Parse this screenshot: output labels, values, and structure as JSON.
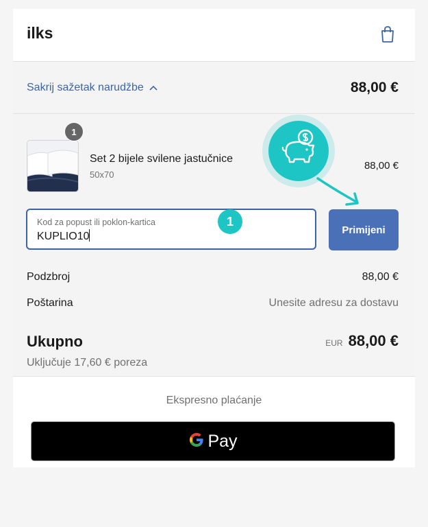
{
  "header": {
    "brand": "ilks",
    "bag_icon": "shopping-bag-icon"
  },
  "summary": {
    "toggle_label": "Sakrij sažetak narudžbe",
    "toggle_icon": "chevron-up-icon",
    "total": "88,00 €"
  },
  "product": {
    "quantity": "1",
    "name": "Set 2 bijele svilene jastučnice",
    "variant": "50x70",
    "price": "88,00 €"
  },
  "discount": {
    "label": "Kod za popust ili poklon-kartica",
    "value": "KUPLIO10",
    "apply_label": "Primijeni"
  },
  "costs": {
    "subtotal_label": "Podzbroj",
    "subtotal_value": "88,00 €",
    "shipping_label": "Poštarina",
    "shipping_value": "Unesite adresu za dostavu",
    "total_label": "Ukupno",
    "currency": "EUR",
    "total_value": "88,00 €",
    "tax_note": "Uključuje 17,60 € poreza"
  },
  "express": {
    "title": "Ekspresno plaćanje",
    "gpay_label": "Pay"
  },
  "tutorial": {
    "step_number": "1",
    "tooltip_icon": "piggy-bank-icon"
  },
  "colors": {
    "accent": "#3b64a8",
    "button": "#4a70b8",
    "tutorial": "#1ec5c5"
  }
}
